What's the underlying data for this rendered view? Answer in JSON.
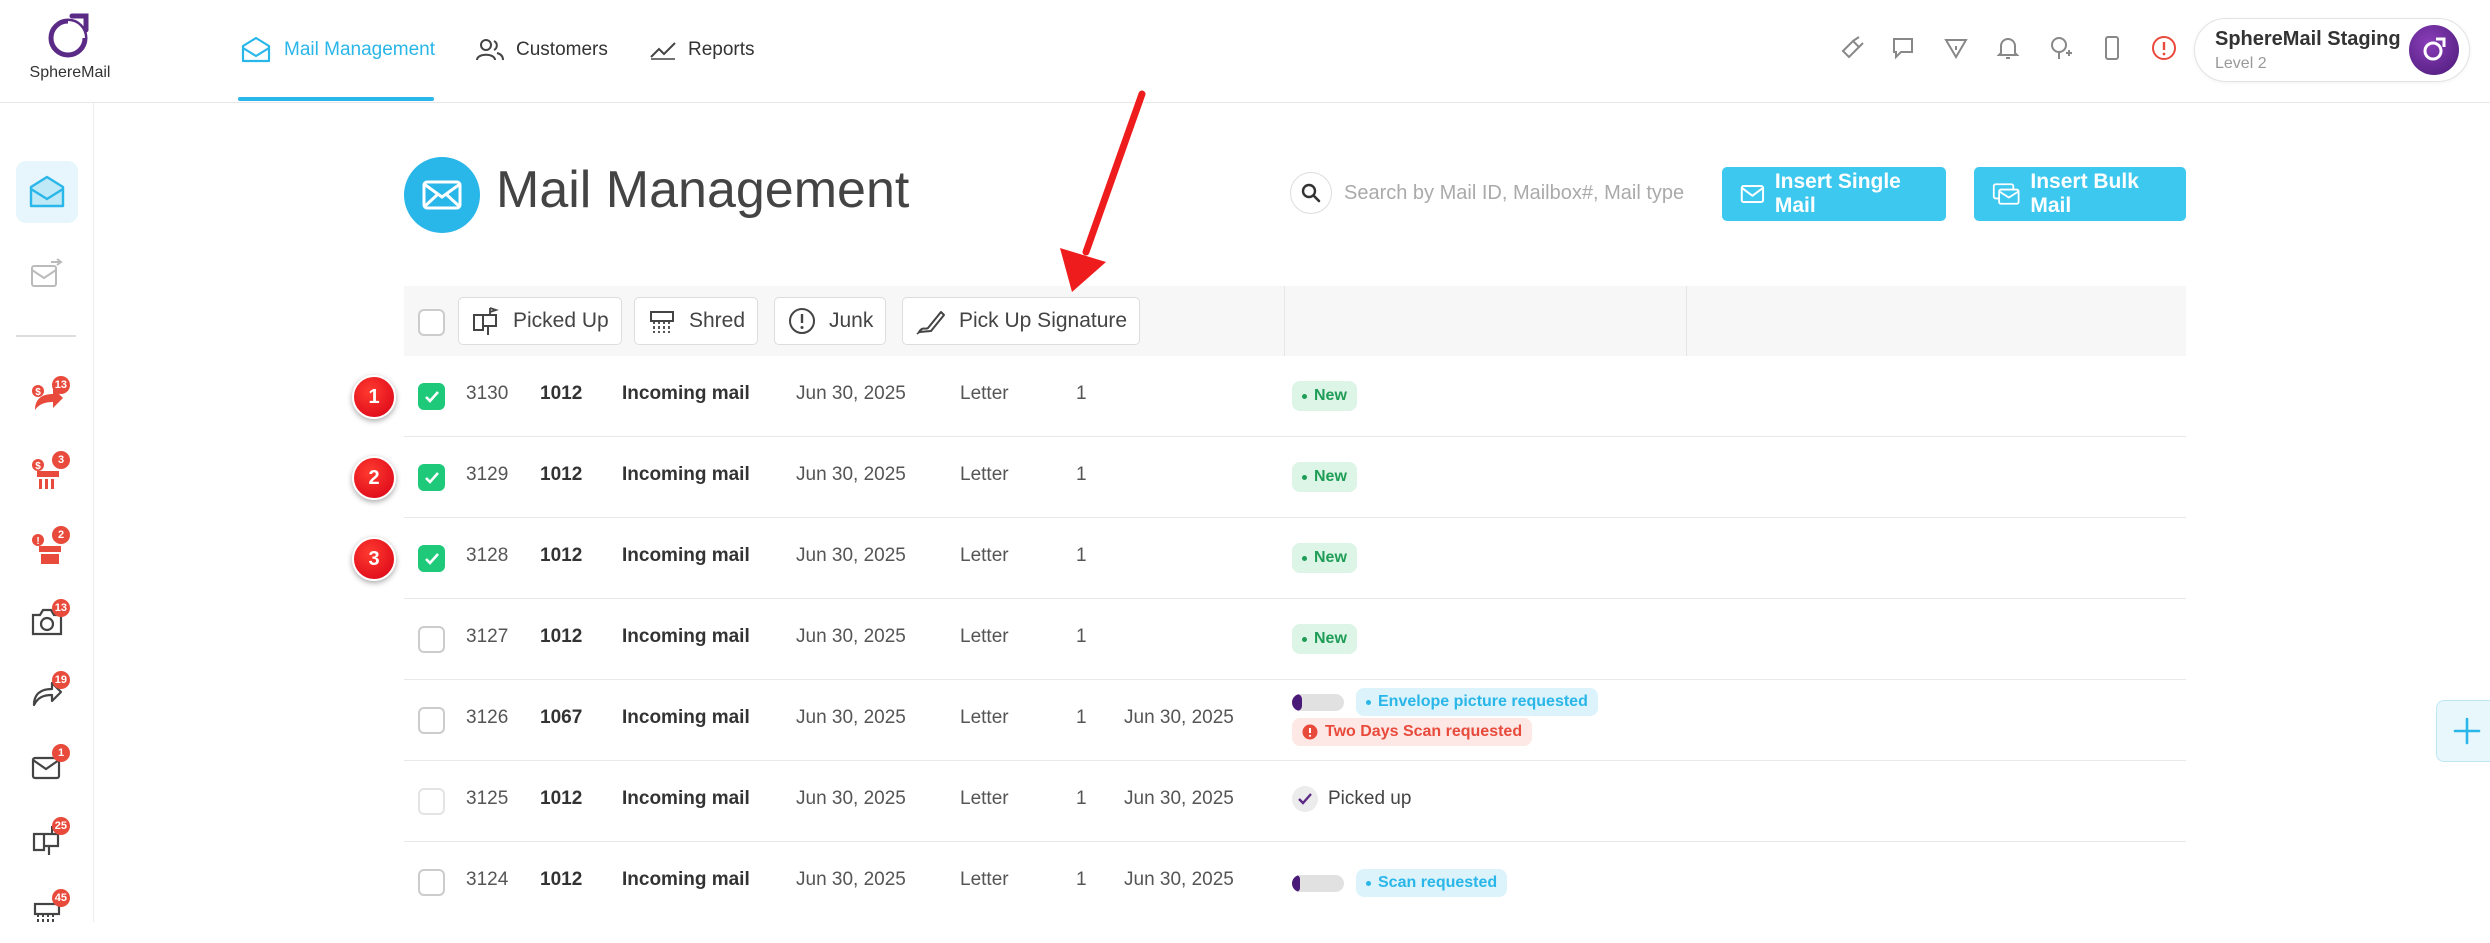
{
  "logo": {
    "text": "SphereMail"
  },
  "nav": {
    "tabs": [
      {
        "label": "Mail Management",
        "icon": "envelope-icon",
        "active": true
      },
      {
        "label": "Customers",
        "icon": "users-icon"
      },
      {
        "label": "Reports",
        "icon": "trend-icon"
      }
    ]
  },
  "account": {
    "name": "SphereMail Staging",
    "level": "Level 2"
  },
  "sidebar": {
    "badges": [
      "13",
      "3",
      "2",
      "13",
      "19",
      "1",
      "25",
      "45"
    ]
  },
  "header": {
    "title": "Mail Management",
    "search_placeholder": "Search by Mail ID, Mailbox#, Mail type",
    "insert_single": "Insert Single Mail",
    "insert_bulk": "Insert Bulk Mail"
  },
  "toolbar": {
    "picked_up": "Picked Up",
    "shred": "Shred",
    "junk": "Junk",
    "pick_up_signature": "Pick Up Signature"
  },
  "markers": [
    "1",
    "2",
    "3"
  ],
  "rows": [
    {
      "id": "3130",
      "mailbox": "1012",
      "type": "Incoming mail",
      "date": "Jun 30, 2025",
      "kind": "Letter",
      "qty": "1",
      "date2": "",
      "status": "New",
      "checked": true
    },
    {
      "id": "3129",
      "mailbox": "1012",
      "type": "Incoming mail",
      "date": "Jun 30, 2025",
      "kind": "Letter",
      "qty": "1",
      "date2": "",
      "status": "New",
      "checked": true
    },
    {
      "id": "3128",
      "mailbox": "1012",
      "type": "Incoming mail",
      "date": "Jun 30, 2025",
      "kind": "Letter",
      "qty": "1",
      "date2": "",
      "status": "New",
      "checked": true
    },
    {
      "id": "3127",
      "mailbox": "1012",
      "type": "Incoming mail",
      "date": "Jun 30, 2025",
      "kind": "Letter",
      "qty": "1",
      "date2": "",
      "status": "New",
      "checked": false
    },
    {
      "id": "3126",
      "mailbox": "1067",
      "type": "Incoming mail",
      "date": "Jun 30, 2025",
      "kind": "Letter",
      "qty": "1",
      "date2": "Jun 30, 2025",
      "status": "Envelope picture requested",
      "status2": "Two Days Scan requested",
      "progress": 0.2,
      "checked": false
    },
    {
      "id": "3125",
      "mailbox": "1012",
      "type": "Incoming mail",
      "date": "Jun 30, 2025",
      "kind": "Letter",
      "qty": "1",
      "date2": "Jun 30, 2025",
      "status": "Picked up",
      "checked": false
    },
    {
      "id": "3124",
      "mailbox": "1012",
      "type": "Incoming mail",
      "date": "Jun 30, 2025",
      "kind": "Letter",
      "qty": "1",
      "date2": "Jun 30, 2025",
      "status": "Scan requested",
      "progress": 0.15,
      "checked": false
    }
  ],
  "colors": {
    "accent": "#29b6e8",
    "button": "#3dc8ef",
    "check": "#1ec97a",
    "new_bg": "#dcf5e6",
    "new_text": "#1f9d57",
    "alert": "#e84a3b",
    "brand_purple": "#4a1a78"
  }
}
